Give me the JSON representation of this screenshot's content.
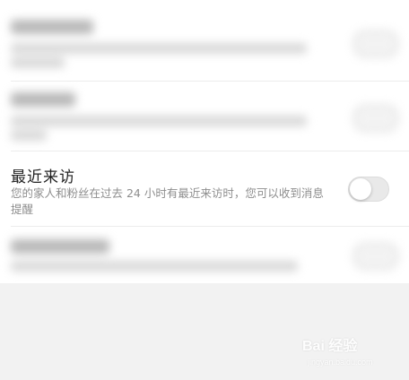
{
  "settings": {
    "recent_visit": {
      "title": "最近来访",
      "description": "您的家人和粉丝在过去 24 小时有最近来访时，您可以收到消息提醒",
      "enabled": false
    }
  },
  "watermark": {
    "logo_text": "Bai 经验",
    "sub_text": "jingyan.baidu.com"
  }
}
